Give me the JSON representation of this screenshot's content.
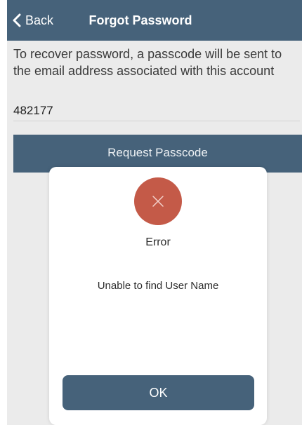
{
  "navbar": {
    "back_label": "Back",
    "title": "Forgot Password"
  },
  "description": "To recover password, a passcode will be sent to the email address associated with this account",
  "passcode_field": {
    "value": "482177"
  },
  "request_button": {
    "label": "Request Passcode"
  },
  "dialog": {
    "icon": "close-icon",
    "title": "Error",
    "message": "Unable to find User Name",
    "ok_label": "OK"
  },
  "colors": {
    "primary": "#46627a",
    "error": "#c45a48",
    "background": "#ebebeb"
  }
}
